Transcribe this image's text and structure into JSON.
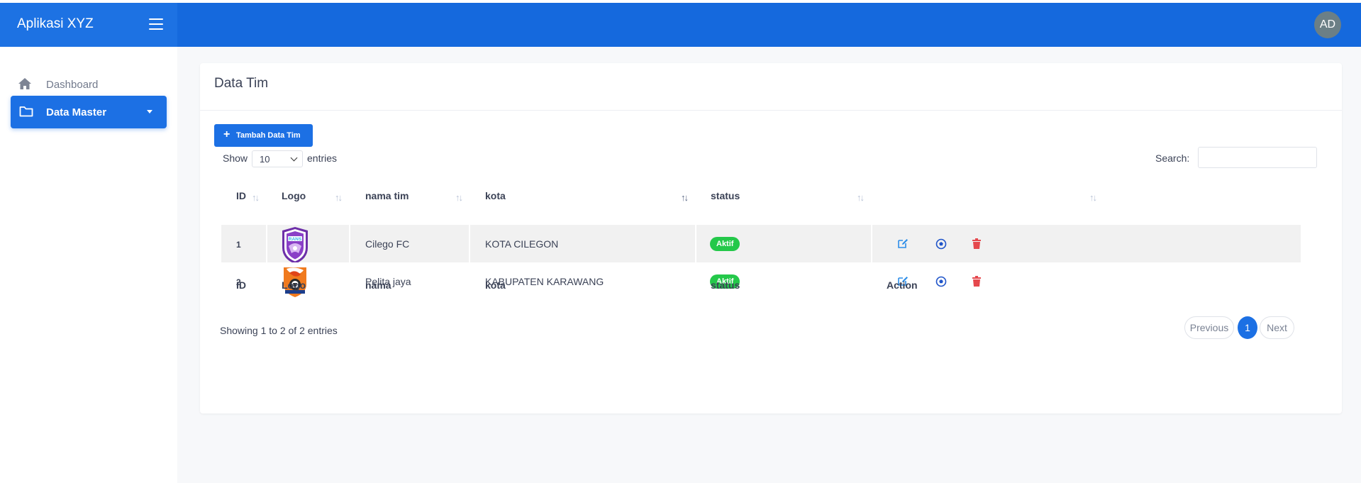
{
  "app": {
    "title": "Aplikasi XYZ",
    "avatar_initials": "AD"
  },
  "sidebar": {
    "items": [
      {
        "label": "Dashboard",
        "icon": "home-icon",
        "active": false
      },
      {
        "label": "Data Master",
        "icon": "folder-icon",
        "active": true
      }
    ]
  },
  "page": {
    "title": "Data Tim",
    "add_button": "Tambah Data Tim",
    "show_label": "Show",
    "entries_value": "10",
    "entries_label": "entries",
    "search_label": "Search:",
    "search_value": ""
  },
  "table": {
    "headers": [
      "ID",
      "Logo",
      "nama tim",
      "kota",
      "status"
    ],
    "footers": [
      "ID",
      "Logo",
      "nama",
      "kota",
      "status",
      "Action"
    ],
    "rows": [
      {
        "id": "1",
        "logo": "rans-logo",
        "nama": "Cilego FC",
        "kota": "KOTA CILEGON",
        "status": "Aktif"
      },
      {
        "id": "2",
        "logo": "pelita-logo",
        "nama": "Pelita jaya",
        "kota": "KABUPATEN KARAWANG",
        "status": "Aktif"
      }
    ]
  },
  "pagination": {
    "info": "Showing 1 to 2 of 2 entries",
    "previous": "Previous",
    "current": "1",
    "next": "Next"
  },
  "colors": {
    "primary": "#1c70e4",
    "topbar": "#1569dd",
    "success": "#24c84a",
    "danger": "#e5484d"
  }
}
